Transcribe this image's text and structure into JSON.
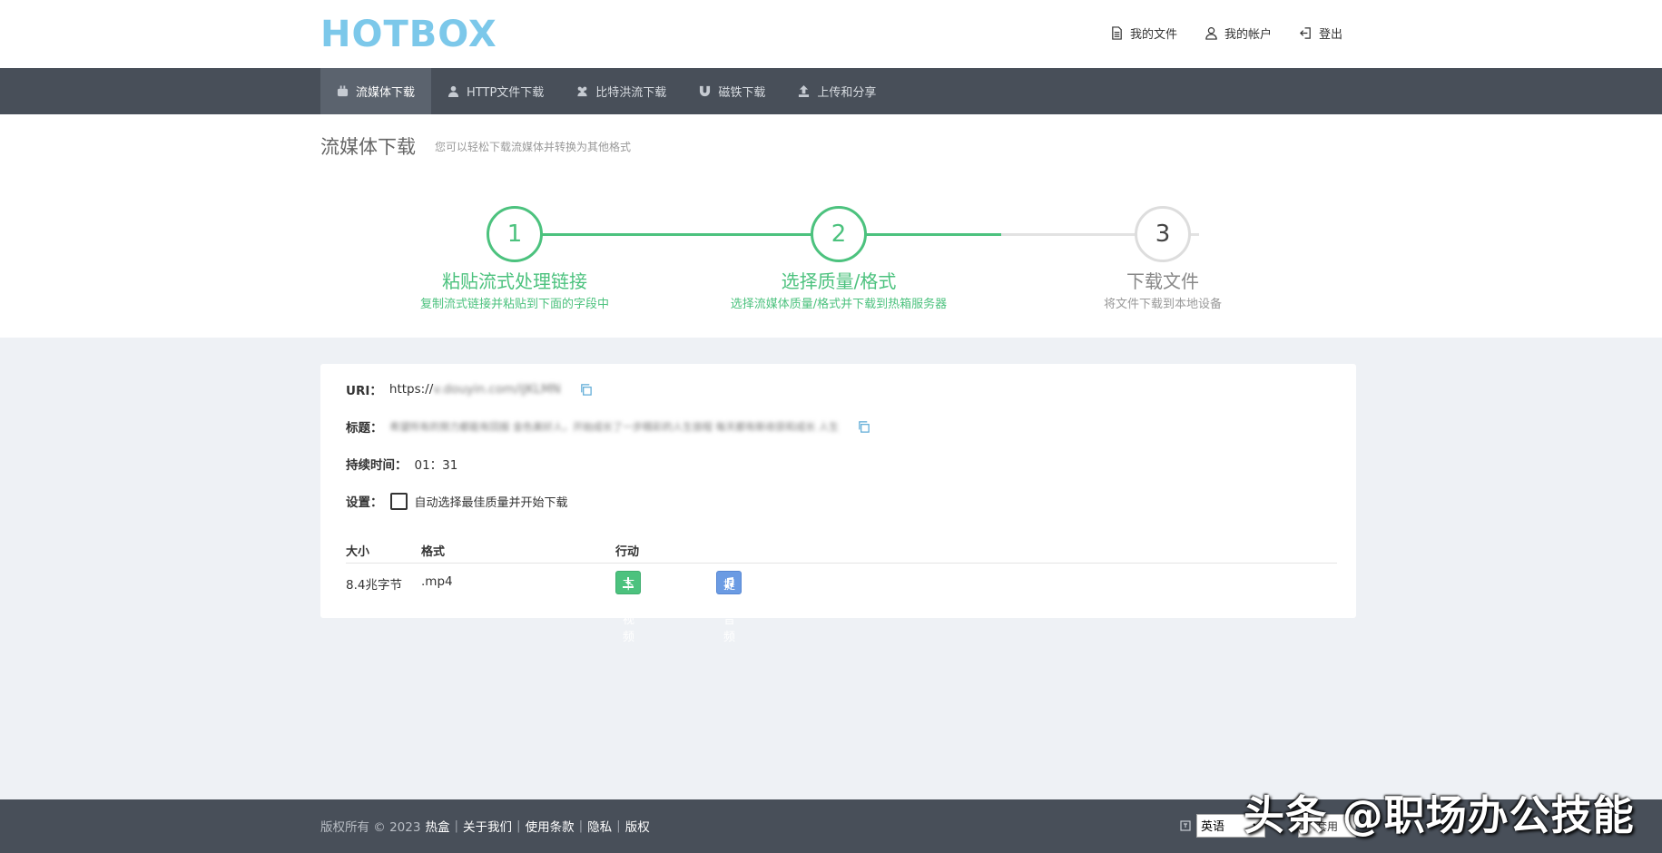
{
  "header": {
    "logo": "HOTBOX",
    "nav": [
      {
        "label": "我的文件",
        "icon": "document-icon"
      },
      {
        "label": "我的帐户",
        "icon": "user-icon"
      },
      {
        "label": "登出",
        "icon": "logout-icon"
      }
    ]
  },
  "tabs": [
    {
      "label": "流媒体下载",
      "icon": "youtube-icon",
      "active": true
    },
    {
      "label": "HTTP文件下载",
      "icon": "user-icon",
      "active": false
    },
    {
      "label": "比特洪流下载",
      "icon": "users-icon",
      "active": false
    },
    {
      "label": "磁铁下载",
      "icon": "magnet-icon",
      "active": false
    },
    {
      "label": "上传和分享",
      "icon": "upload-icon",
      "active": false
    }
  ],
  "page": {
    "title": "流媒体下载",
    "subtitle": "您可以轻松下载流媒体并转换为其他格式"
  },
  "steps": [
    {
      "number": "1",
      "title": "粘贴流式处理链接",
      "desc": "复制流式链接并粘贴到下面的字段中",
      "done": true
    },
    {
      "number": "2",
      "title": "选择质量/格式",
      "desc": "选择流媒体质量/格式并下载到热箱服务器",
      "done": true
    },
    {
      "number": "3",
      "title": "下载文件",
      "desc": "将文件下载到本地设备",
      "done": false
    }
  ],
  "info": {
    "uri_label": "URI：",
    "uri_prefix": "https://",
    "uri_hidden": "v.douyin.com/iJKLMN",
    "title_label": "标题：",
    "title_hidden": "希望所有的努力都能有回报 金色美好人，开始成长了一步精彩的人生旅程 每天都有新收获和成长 人生",
    "duration_label": "持续时间：",
    "duration_value": "01：31",
    "settings_label": "设置：",
    "auto_select_label": "自动选择最佳质量并开始下载"
  },
  "table": {
    "headers": [
      "大小",
      "格式",
      "行动"
    ],
    "rows": [
      {
        "size": "8.4兆字节",
        "format": ".mp4",
        "download_label": "下载视频",
        "audio_label": "提取音频"
      }
    ]
  },
  "footer": {
    "copyright": "版权所有 © 2023",
    "links": [
      "热盒",
      "关于我们",
      "使用条款",
      "隐私",
      "版权"
    ],
    "language": "英语",
    "apply": "套用"
  },
  "watermark": "头条 @职场办公技能",
  "colors": {
    "accent_green": "#4cc27e",
    "accent_blue": "#6b9be3",
    "logo": "#7cc8ea",
    "navbar": "#484f59"
  }
}
